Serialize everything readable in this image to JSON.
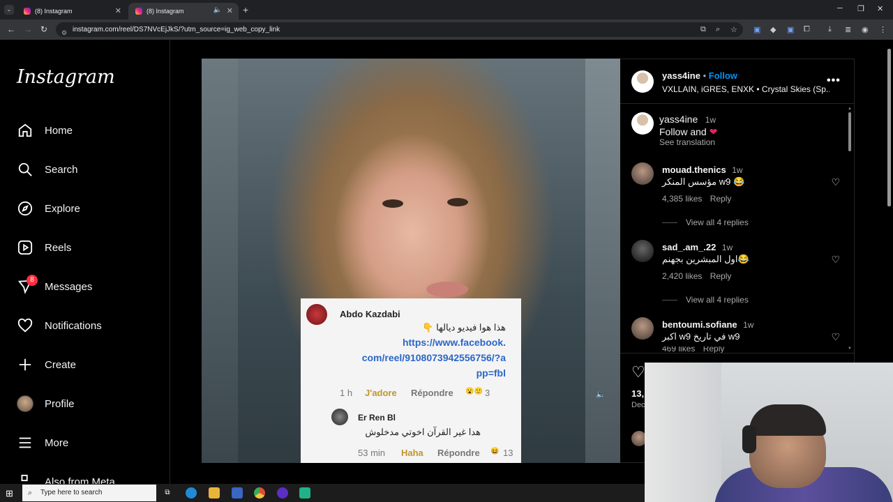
{
  "browser": {
    "tabs": [
      {
        "title": "(8) Instagram"
      },
      {
        "title": "(8) Instagram"
      }
    ],
    "new_tab_icon": "plus-icon",
    "url": "instagram.com/reel/DS7NVcEjJkS/?utm_source=ig_web_copy_link"
  },
  "sidebar": {
    "logo": "Instagram",
    "items": [
      {
        "label": "Home",
        "icon": "home-icon"
      },
      {
        "label": "Search",
        "icon": "search-icon"
      },
      {
        "label": "Explore",
        "icon": "compass-icon"
      },
      {
        "label": "Reels",
        "icon": "reels-icon"
      },
      {
        "label": "Messages",
        "icon": "messenger-icon",
        "badge": "8"
      },
      {
        "label": "Notifications",
        "icon": "heart-icon"
      },
      {
        "label": "Create",
        "icon": "plus-icon"
      },
      {
        "label": "Profile",
        "icon": "avatar"
      },
      {
        "label": "More",
        "icon": "menu-icon"
      },
      {
        "label": "Also from Meta",
        "icon": "meta-icon"
      }
    ]
  },
  "reel_overlay": {
    "comment1": {
      "name": "Abdo Kazdabi",
      "text": "هذا هوا فيديو ديالها 👇",
      "link_lines": [
        "https://www.facebook.",
        "com/reel/9108073942556756/?a",
        "pp=fbl"
      ],
      "time": "1 h",
      "reaction": "J'adore",
      "reply": "Répondre",
      "count": "3"
    },
    "comment2": {
      "name": "Er Ren Bl",
      "text": "هدا غير القرآن اخوتي مدخلوش",
      "time": "53 min",
      "reaction": "Haha",
      "reply": "Répondre",
      "count": "13"
    }
  },
  "panel": {
    "author": {
      "username": "yass4ine",
      "follow": "Follow",
      "audio": "VXLLAIN, iGRES, ENXK • Crystal Skies (Sp..."
    },
    "caption": {
      "username": "yass4ine",
      "time": "1w",
      "text": "Follow and",
      "see_translation": "See translation"
    },
    "comments": [
      {
        "username": "mouad.thenics",
        "time": "1w",
        "text": "مؤسس المنكر w9 😂",
        "likes": "4,385 likes",
        "reply": "Reply",
        "view_replies": "View all 4 replies"
      },
      {
        "username": "sad_.am_.22",
        "time": "1w",
        "text": "اول المبشرين بجهنم😂",
        "likes": "2,420 likes",
        "reply": "Reply",
        "view_replies": "View all 4 replies"
      },
      {
        "username": "bentoumi.sofiane",
        "time": "1w",
        "text": "اكبر w9 في تاريخ w9",
        "likes": "469 likes",
        "reply": "Reply"
      }
    ],
    "likes_partial": "13,",
    "date_partial": "Dec"
  },
  "taskbar": {
    "search_placeholder": "Type here to search"
  },
  "colors": {
    "follow_blue": "#0095f6",
    "notification_red": "#ff3040",
    "background": "#000000"
  }
}
